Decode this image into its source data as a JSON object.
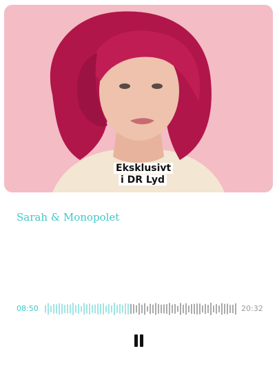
{
  "player": {
    "cover_badge_line1": "Eksklusivt",
    "cover_badge_line2": "i DR Lyd",
    "show_title": "Sarah & Monopolet",
    "elapsed": "08:50",
    "duration": "20:32",
    "progress": 0.43,
    "pause_icon": "pause-icon"
  },
  "colors": {
    "accent": "#40c8c8",
    "muted": "#9a9a9a",
    "cover_background": "#f3b9c2",
    "hair": "#b0164a"
  }
}
